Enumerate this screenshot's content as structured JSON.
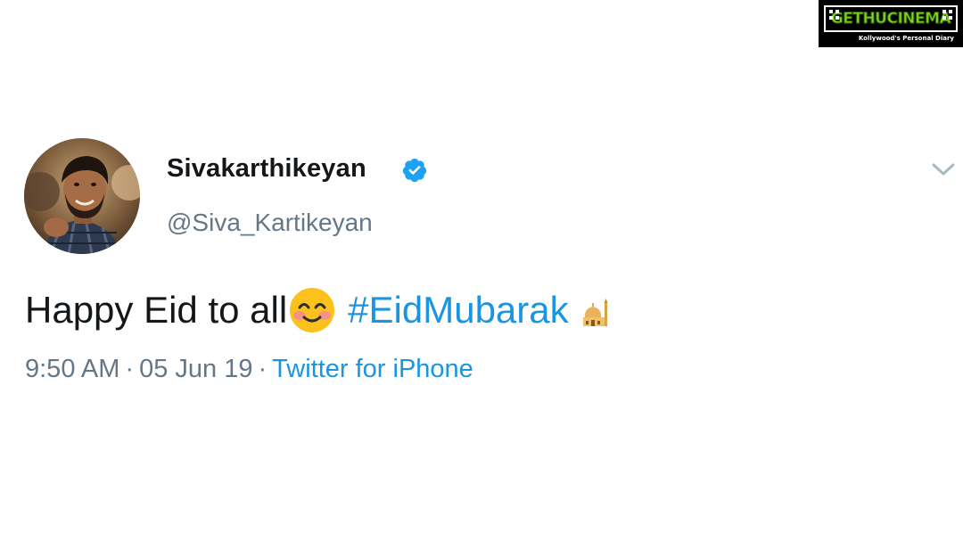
{
  "watermark": {
    "brand": "GETHUCINEMA",
    "tagline": "Kollywood's Personal Diary"
  },
  "tweet": {
    "author": {
      "display_name": "Sivakarthikeyan",
      "handle": "@Siva_Kartikeyan",
      "verified": true
    },
    "text": "Happy Eid to all",
    "emoji_smile": "smiling-face-with-smiling-eyes",
    "hashtag": "#EidMubarak",
    "emoji_end": "mosque",
    "time": "9:50 AM",
    "separator": "·",
    "date": "05 Jun 19",
    "source": "Twitter for iPhone"
  },
  "colors": {
    "link": "#1b95e0",
    "text": "#14171a",
    "muted": "#657786",
    "verified": "#1da1f2",
    "watermark_green": "#7ed321"
  }
}
